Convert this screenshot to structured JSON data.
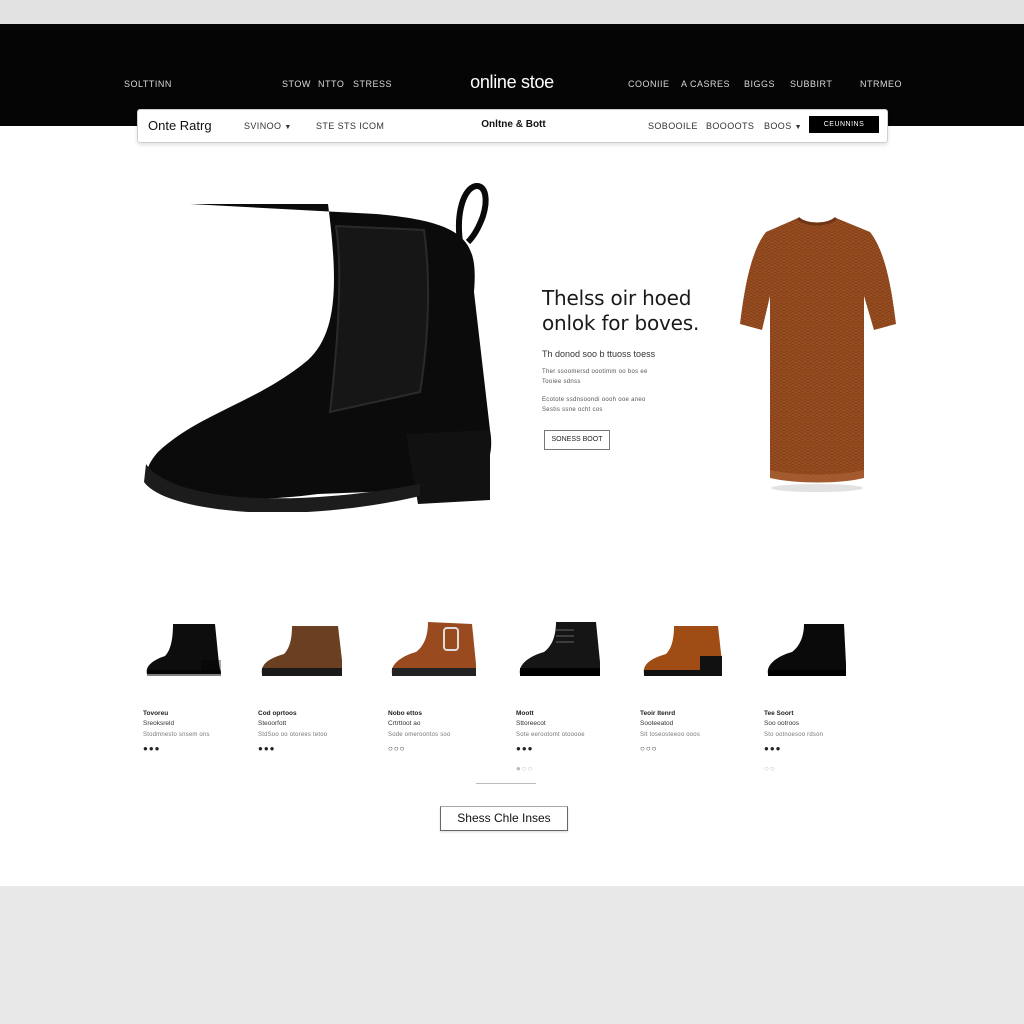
{
  "header": {
    "left_link": "SOLTTINN",
    "nav_links": [
      "STOW",
      "NTTO",
      "STRESS"
    ],
    "brand": "online stoe",
    "right_links": [
      "COONIIE",
      "A CASRES",
      "BIGGS",
      "SUBBIRT"
    ],
    "account_link": "NTRMEO"
  },
  "subbar": {
    "logo": "Onte Ratrg",
    "dropdown": "SVINOO",
    "search_label": "STE STS ICOM",
    "center_title": "Onltne & Bott",
    "links": [
      "SOBOOILE",
      "BOOOOTS"
    ],
    "more_dropdown": "BOOS",
    "cta": "CEUNNINS"
  },
  "hero": {
    "title_line1": "Thelss oir hoed",
    "title_line2": "onlok for boves.",
    "subtitle": "Th donod soo b ttuoss toess",
    "line1": "Ther ssoomersd oootimm oo bos ee",
    "line2": "Tooiee sdnss",
    "line3": "Ecotote ssdnsoondi oooh ooe aneo",
    "line4": "Sestis ssne ocht cos",
    "button": "SONESS BOOT"
  },
  "products": [
    {
      "name": "Tovoreu",
      "category": "Sreoksreld",
      "desc": "Stodmnesto snsem ons",
      "dots": "●●●",
      "color": "#0d0d0d",
      "second_dots": ""
    },
    {
      "name": "Cod oprtoos",
      "category": "Steoorfott",
      "desc": "StdSoo oo otorees tetoo",
      "dots": "●●●",
      "color": "#6b3f22",
      "second_dots": ""
    },
    {
      "name": "Nobo ettos",
      "category": "Crtrttoot ao",
      "desc": "Sode omeroontos soo",
      "dots": "○○○",
      "color": "#9a4a1f",
      "second_dots": ""
    },
    {
      "name": "Moott",
      "category": "Sttoreecot",
      "desc": "Sote eerootomt otooooe",
      "dots": "●●●",
      "color": "#151515",
      "second_dots": "●○○"
    },
    {
      "name": "Teoir Itenrd",
      "category": "Sooteeatod",
      "desc": "Slt toseosteeoo ooos",
      "dots": "○○○",
      "color": "#a04d15",
      "second_dots": ""
    },
    {
      "name": "Tee Soort",
      "category": "Soo ootroos",
      "desc": "Sto ootnoesoo rdson",
      "dots": "●●●",
      "color": "#0a0a0a",
      "second_dots": "○○"
    }
  ],
  "more_button": "Shess Chle Inses",
  "colors": {
    "header_bg": "#050505",
    "boot_black": "#0a0a0a",
    "dress_rust": "#9a4e22",
    "brown": "#6b3f22"
  },
  "icons": [
    "chevron-down-icon"
  ]
}
